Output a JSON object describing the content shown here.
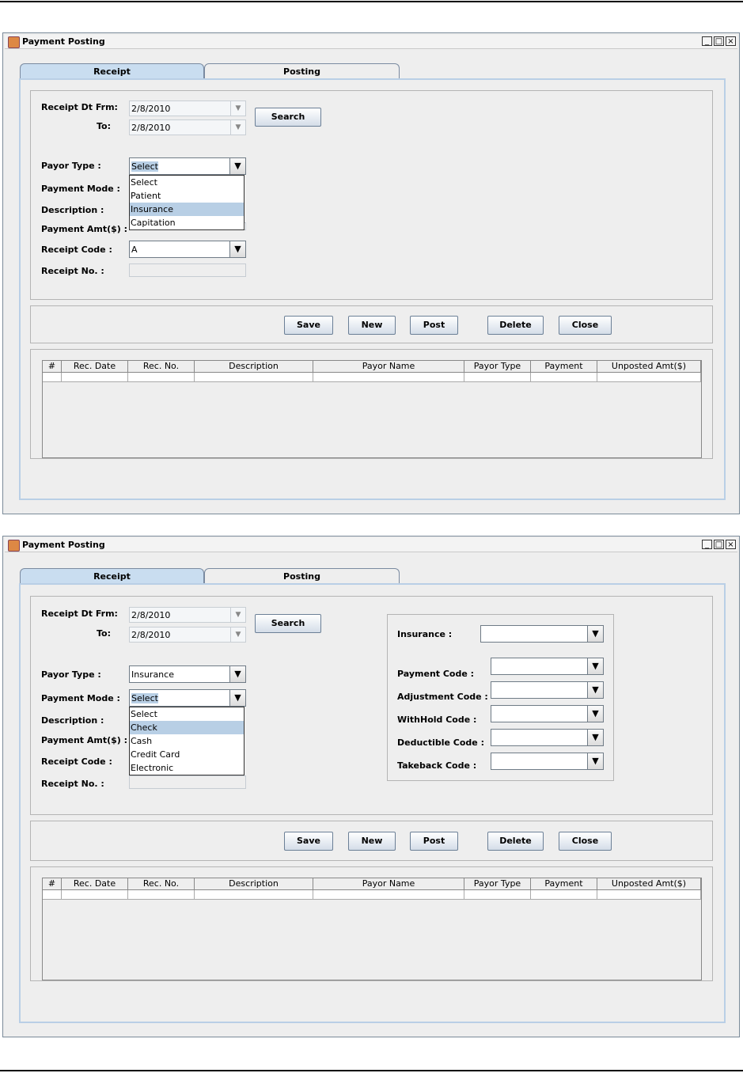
{
  "window_title": "Payment Posting",
  "window_buttons": {
    "minimize": "_",
    "maximize": "□",
    "close": "×"
  },
  "tabs": [
    "Receipt",
    "Posting"
  ],
  "labels": {
    "receipt_from": "Receipt Dt Frm:",
    "to": "To:",
    "payor_type": "Payor Type :",
    "payment_mode": "Payment Mode :",
    "description": "Description :",
    "payment_amt": "Payment Amt($) :",
    "receipt_code": "Receipt Code :",
    "receipt_no": "Receipt No. :"
  },
  "buttons": {
    "search": "Search",
    "save": "Save",
    "new": "New",
    "post": "Post",
    "delete": "Delete",
    "close": "Close"
  },
  "table_headers": [
    "#",
    "Rec. Date",
    "Rec. No.",
    "Description",
    "Payor Name",
    "Payor Type",
    "Payment",
    "Unposted Amt($)"
  ],
  "screen1": {
    "date_from": "2/8/2010",
    "date_to": "2/8/2010",
    "payor_type": "Select",
    "receipt_code": "A",
    "payor_dropdown": [
      "Select",
      "Patient",
      "Insurance",
      "Capitation"
    ],
    "payor_highlight": "Insurance"
  },
  "screen2": {
    "date_from": "2/8/2010",
    "date_to": "2/8/2010",
    "payor_type": "Insurance",
    "payment_mode": "Select",
    "mode_dropdown": [
      "Select",
      "Check",
      "Cash",
      "Credit Card",
      "Electronic"
    ],
    "mode_highlight": "Check",
    "insurance_labels": {
      "insurance": "Insurance :",
      "payment_code": "Payment Code :",
      "adjustment_code": "Adjustment Code :",
      "withhold_code": "WithHold Code :",
      "deductible_code": "Deductible Code :",
      "takeback_code": "Takeback Code :"
    }
  }
}
